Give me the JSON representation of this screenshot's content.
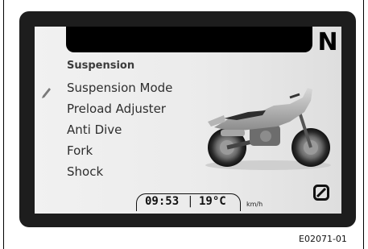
{
  "display": {
    "gear": "N",
    "menu": {
      "title": "Suspension",
      "items": [
        {
          "label": "Suspension Mode",
          "selected": true
        },
        {
          "label": "Preload Adjuster"
        },
        {
          "label": "Anti Dive"
        },
        {
          "label": "Fork"
        },
        {
          "label": "Shock"
        }
      ]
    },
    "status": {
      "time": "09:53",
      "separator": "|",
      "temperature": "19°C",
      "speed_unit": "km/h"
    },
    "icons": {
      "edit": "pencil-icon",
      "trip": "zero-reset-icon",
      "image": "motorcycle-image"
    }
  },
  "figure_id": "E02071-01"
}
